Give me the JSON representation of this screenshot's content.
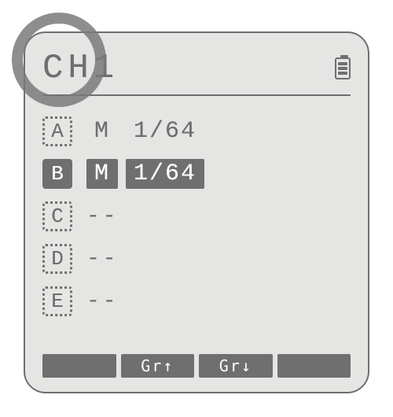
{
  "header": {
    "title": "CH1",
    "battery_level": 3
  },
  "groups": [
    {
      "id": "A",
      "selected": false,
      "mode": "M",
      "ratio": "1/64",
      "highlight": false
    },
    {
      "id": "B",
      "selected": true,
      "mode": "M",
      "ratio": "1/64",
      "highlight": true
    },
    {
      "id": "C",
      "selected": false,
      "mode": null,
      "ratio": null,
      "empty": "--"
    },
    {
      "id": "D",
      "selected": false,
      "mode": null,
      "ratio": null,
      "empty": "--"
    },
    {
      "id": "E",
      "selected": false,
      "mode": null,
      "ratio": null,
      "empty": "--"
    }
  ],
  "softkeys": {
    "k1": "",
    "k2": "Gr↑",
    "k3": "Gr↓",
    "k4": ""
  },
  "icons": {
    "battery": "battery-icon"
  },
  "callout": {
    "target": "channel-title"
  }
}
